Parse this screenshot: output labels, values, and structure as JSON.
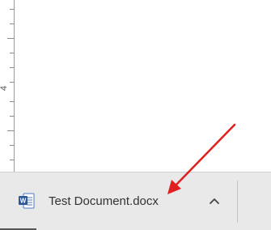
{
  "ruler": {
    "number_label": "4"
  },
  "download_bar": {
    "file_name": "Test Document.docx",
    "file_icon": "word-document-icon",
    "expand_icon": "chevron-up-icon"
  },
  "annotation": {
    "arrow_color": "#e02020"
  }
}
